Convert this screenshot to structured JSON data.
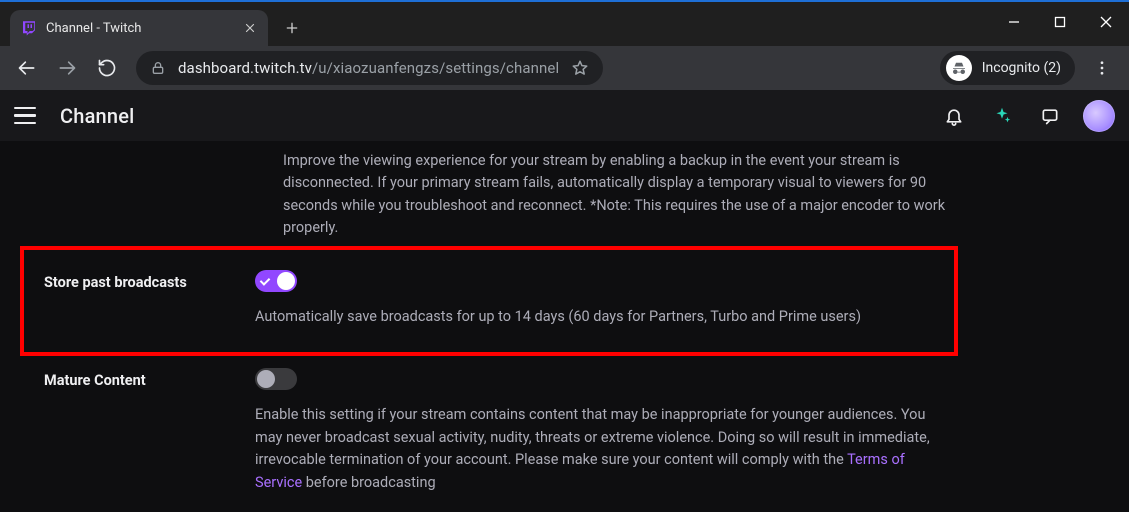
{
  "window": {
    "tab_title": "Channel - Twitch",
    "incognito_label": "Incognito (2)"
  },
  "omnibox": {
    "host": "dashboard.twitch.tv",
    "path": "/u/xiaozuanfengzs/settings/channel"
  },
  "topnav": {
    "title": "Channel"
  },
  "prev_setting_desc": "Improve the viewing experience for your stream by enabling a backup in the event your stream is disconnected. If your primary stream fails, automatically display a temporary visual to viewers for 90 seconds while you troubleshoot and reconnect. *Note: This requires the use of a major encoder to work properly.",
  "settings": {
    "store_past": {
      "label": "Store past broadcasts",
      "on": true,
      "desc": "Automatically save broadcasts for up to 14 days (60 days for Partners, Turbo and Prime users)"
    },
    "mature": {
      "label": "Mature Content",
      "on": false,
      "desc_a": "Enable this setting if your stream contains content that may be inappropriate for younger audiences. You may never broadcast sexual activity, nudity, threats or extreme violence. Doing so will result in immediate, irrevocable termination of your account. Please make sure your content will comply with the ",
      "tos": "Terms of Service",
      "desc_b": " before broadcasting"
    }
  }
}
